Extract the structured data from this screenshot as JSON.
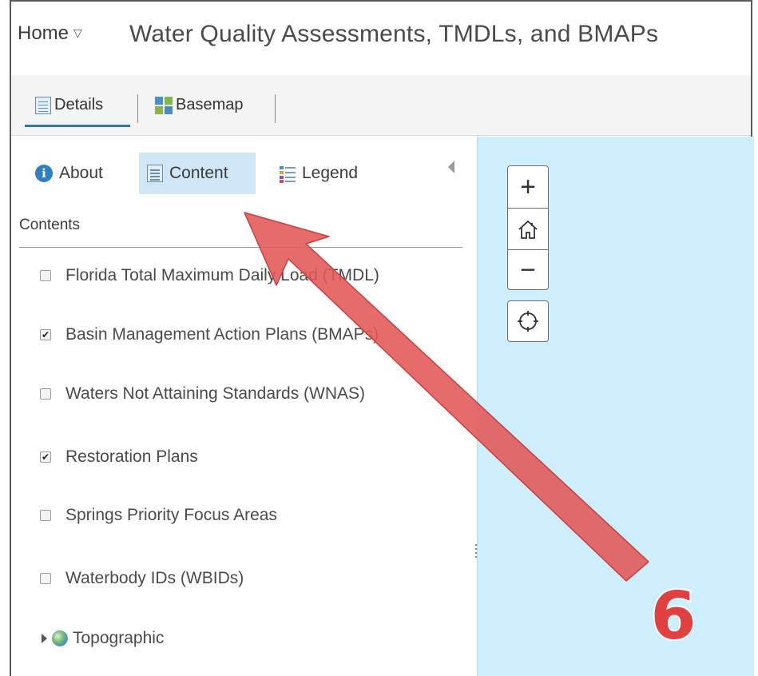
{
  "header": {
    "home_label": "Home",
    "home_caret": "▽",
    "title": "Water Quality Assessments, TMDLs, and BMAPs"
  },
  "toolbar": {
    "details_label": "Details",
    "basemap_label": "Basemap",
    "active": "Details"
  },
  "panel": {
    "tabs": [
      {
        "label": "About",
        "icon": "info-icon"
      },
      {
        "label": "Content",
        "icon": "content-icon",
        "selected": true
      },
      {
        "label": "Legend",
        "icon": "legend-icon"
      }
    ],
    "contents_heading": "Contents",
    "layers": [
      {
        "label": "Florida Total Maximum Daily Load (TMDL)",
        "checked": false
      },
      {
        "label": "Basin Management Action Plans (BMAPs)",
        "checked": true
      },
      {
        "label": "Waters Not Attaining Standards (WNAS)",
        "checked": false
      },
      {
        "label": "Restoration Plans",
        "checked": true
      },
      {
        "label": "Springs Priority Focus Areas",
        "checked": false
      },
      {
        "label": "Waterbody IDs (WBIDs)",
        "checked": false
      }
    ],
    "basemap_layer": {
      "label": "Topographic",
      "icon": "globe-icon"
    }
  },
  "map": {
    "zoom_in": "+",
    "zoom_out": "−",
    "background_color": "#cdeefc"
  },
  "annotation": {
    "step_number": "6",
    "arrow_color": "#e35656"
  }
}
